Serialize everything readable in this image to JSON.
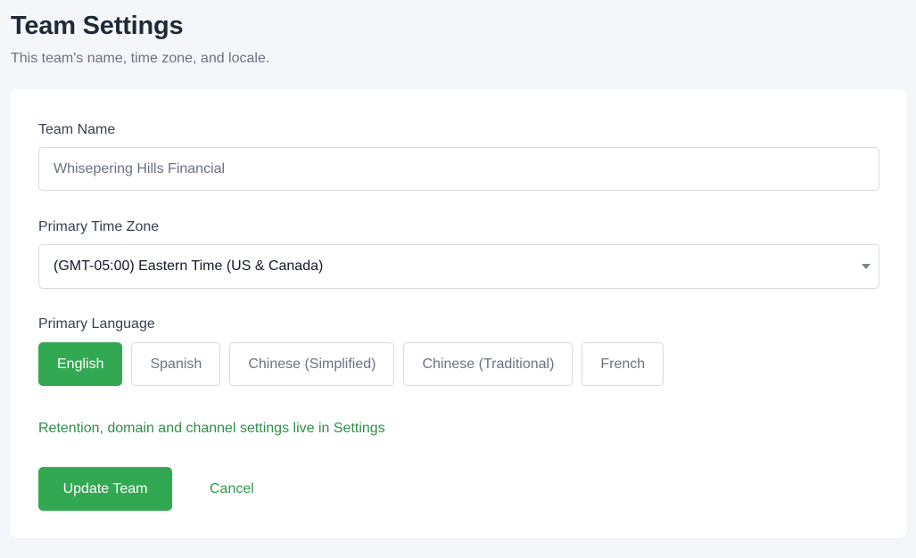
{
  "header": {
    "title": "Team Settings",
    "subtitle": "This team's name, time zone, and locale."
  },
  "form": {
    "team_name": {
      "label": "Team Name",
      "value": "Whisepering Hills Financial"
    },
    "time_zone": {
      "label": "Primary Time Zone",
      "selected": "(GMT-05:00) Eastern Time (US & Canada)",
      "caret_icon": "caret-down-icon"
    },
    "language": {
      "label": "Primary Language",
      "options": [
        {
          "label": "English",
          "active": true
        },
        {
          "label": "Spanish",
          "active": false
        },
        {
          "label": "Chinese (Simplified)",
          "active": false
        },
        {
          "label": "Chinese (Traditional)",
          "active": false
        },
        {
          "label": "French",
          "active": false
        }
      ]
    },
    "info_link": "Retention, domain and channel settings live in Settings",
    "update_label": "Update Team",
    "cancel_label": "Cancel"
  },
  "colors": {
    "accent": "#33a852",
    "link": "#2f8f46",
    "background": "#f4f6f9",
    "card": "#ffffff"
  }
}
